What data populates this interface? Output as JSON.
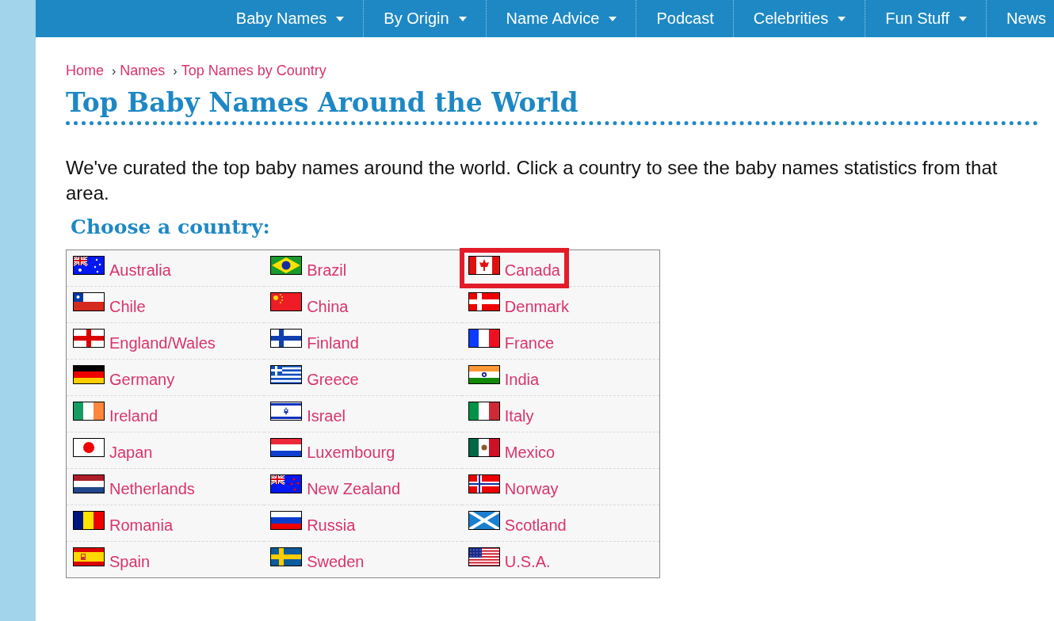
{
  "nav": [
    {
      "label": "Baby Names",
      "dropdown": true
    },
    {
      "label": "By Origin",
      "dropdown": true
    },
    {
      "label": "Name Advice",
      "dropdown": true
    },
    {
      "label": "Podcast",
      "dropdown": false
    },
    {
      "label": "Celebrities",
      "dropdown": true
    },
    {
      "label": "Fun Stuff",
      "dropdown": true
    },
    {
      "label": "News",
      "dropdown": false
    }
  ],
  "breadcrumb": [
    {
      "label": "Home"
    },
    {
      "label": "Names"
    },
    {
      "label": "Top Names by Country"
    }
  ],
  "breadcrumb_separator": "›",
  "title": "Top Baby Names Around the World",
  "intro": "We've curated the top baby names around the world. Click a country to see the baby names statistics from that area.",
  "subtitle": "Choose a country:",
  "table": {
    "rows": [
      {
        "cells": [
          {
            "label": "Australia",
            "kind": "au",
            "highlighted": false
          },
          {
            "label": "Brazil",
            "kind": "br",
            "highlighted": false
          },
          {
            "label": "Canada",
            "kind": "ca",
            "highlighted": true
          }
        ]
      },
      {
        "cells": [
          {
            "label": "Chile",
            "kind": "cl",
            "highlighted": false
          },
          {
            "label": "China",
            "kind": "cn",
            "highlighted": false
          },
          {
            "label": "Denmark",
            "kind": "dk",
            "highlighted": false
          }
        ]
      },
      {
        "cells": [
          {
            "label": "England/Wales",
            "kind": "en",
            "highlighted": false
          },
          {
            "label": "Finland",
            "kind": "fi",
            "highlighted": false
          },
          {
            "label": "France",
            "kind": "fr",
            "highlighted": false
          }
        ]
      },
      {
        "cells": [
          {
            "label": "Germany",
            "kind": "de",
            "highlighted": false
          },
          {
            "label": "Greece",
            "kind": "gr",
            "highlighted": false
          },
          {
            "label": "India",
            "kind": "in",
            "highlighted": false
          }
        ]
      },
      {
        "cells": [
          {
            "label": "Ireland",
            "kind": "ie",
            "highlighted": false
          },
          {
            "label": "Israel",
            "kind": "il",
            "highlighted": false
          },
          {
            "label": "Italy",
            "kind": "it",
            "highlighted": false
          }
        ]
      },
      {
        "cells": [
          {
            "label": "Japan",
            "kind": "jp",
            "highlighted": false
          },
          {
            "label": "Luxembourg",
            "kind": "lu",
            "highlighted": false
          },
          {
            "label": "Mexico",
            "kind": "mx",
            "highlighted": false
          }
        ]
      },
      {
        "cells": [
          {
            "label": "Netherlands",
            "kind": "nl",
            "highlighted": false
          },
          {
            "label": "New Zealand",
            "kind": "nz",
            "highlighted": false
          },
          {
            "label": "Norway",
            "kind": "no",
            "highlighted": false
          }
        ]
      },
      {
        "cells": [
          {
            "label": "Romania",
            "kind": "ro",
            "highlighted": false
          },
          {
            "label": "Russia",
            "kind": "ru",
            "highlighted": false
          },
          {
            "label": "Scotland",
            "kind": "sc",
            "highlighted": false
          }
        ]
      },
      {
        "cells": [
          {
            "label": "Spain",
            "kind": "es",
            "highlighted": false
          },
          {
            "label": "Sweden",
            "kind": "se",
            "highlighted": false
          },
          {
            "label": "U.S.A.",
            "kind": "us",
            "highlighted": false
          }
        ]
      }
    ]
  }
}
